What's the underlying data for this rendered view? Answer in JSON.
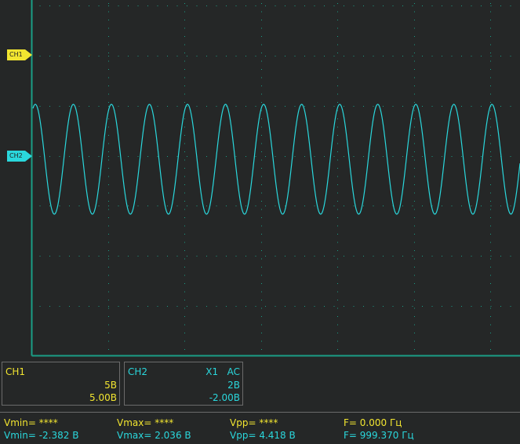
{
  "colors": {
    "background": "#252727",
    "grid": "#1a9e86",
    "ch1": "#f2e530",
    "ch2": "#2ad7dc"
  },
  "markers": {
    "ch1": "CH1",
    "ch2": "CH2"
  },
  "waveform": {
    "channel": "CH2",
    "shape": "sine",
    "cycles_visible": 13
  },
  "ch1_panel": {
    "name": "CH1",
    "scale": "5В",
    "offset": "5.00В"
  },
  "ch2_panel": {
    "name": "CH2",
    "probe": "X1",
    "coupling": "AC",
    "scale": "2В",
    "offset": "-2.00В"
  },
  "measurements": {
    "ch1": {
      "vmin": "Vmin= ****",
      "vmax": "Vmax= ****",
      "vpp": "Vpp= ****",
      "freq": "F= 0.000 Гц"
    },
    "ch2": {
      "vmin": "Vmin= -2.382 В",
      "vmax": "Vmax= 2.036 В",
      "vpp": "Vpp= 4.418 В",
      "freq": "F= 999.370 Гц"
    }
  }
}
